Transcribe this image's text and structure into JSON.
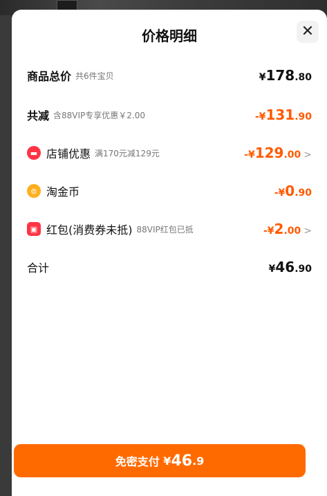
{
  "sheet": {
    "title": "价格明细",
    "close_icon": "close-icon"
  },
  "rows": {
    "total": {
      "label": "商品总价",
      "sub": "共6件宝贝",
      "currency": "¥",
      "int": "178",
      "dec": ".80"
    },
    "reduced": {
      "label": "共减",
      "sub": "含88VIP专享优惠￥2.00",
      "sign": "-¥",
      "int": "131",
      "dec": ".90"
    },
    "shop_discount": {
      "icon": "shop-icon",
      "label": "店铺优惠",
      "sub": "满170元减129元",
      "sign": "-¥",
      "int": "129",
      "dec": ".00",
      "chevron": ">"
    },
    "gold_coin": {
      "icon": "coin-icon",
      "label": "淘金币",
      "sign": "-¥",
      "int": "0",
      "dec": ".90"
    },
    "red_packet": {
      "icon": "red-packet-icon",
      "label": "红包(消费券未抵)",
      "sub": "88VIP红包已抵",
      "sign": "-¥",
      "int": "2",
      "dec": ".00",
      "chevron": ">"
    },
    "sum": {
      "label": "合计",
      "currency": "¥",
      "int": "46",
      "dec": ".90"
    }
  },
  "pay_button": {
    "label": "免密支付",
    "currency": "¥",
    "int": "46",
    "dec": ".9"
  },
  "colors": {
    "accent": "#ff6a00",
    "discount": "#ff5a00",
    "icon_red": "#ff3344",
    "icon_gold": "#ffb01f"
  }
}
